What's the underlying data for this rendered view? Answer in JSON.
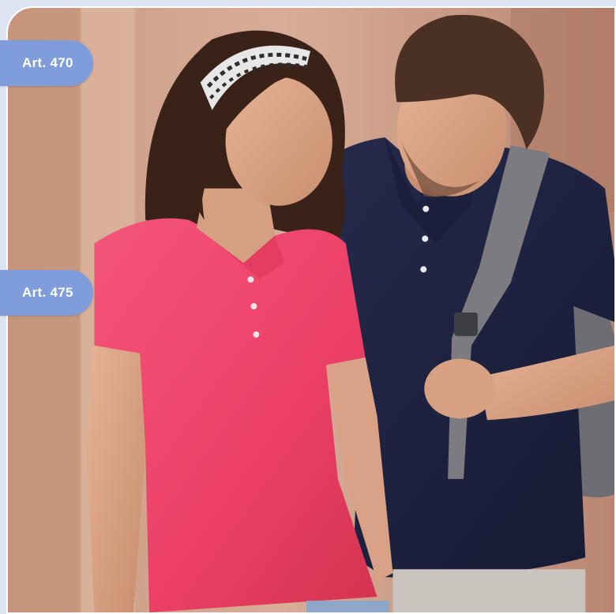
{
  "badges": {
    "top": {
      "label": "Art. 470"
    },
    "bottom": {
      "label": "Art. 475"
    }
  },
  "photo": {
    "subject": "two-people-wearing-polo-shirts"
  },
  "colors": {
    "badge": "#7f9ddb",
    "badge_text": "#ffffff",
    "frame": "#dde3f1",
    "pink_polo": "#f0456c",
    "navy_polo": "#1e2240"
  }
}
